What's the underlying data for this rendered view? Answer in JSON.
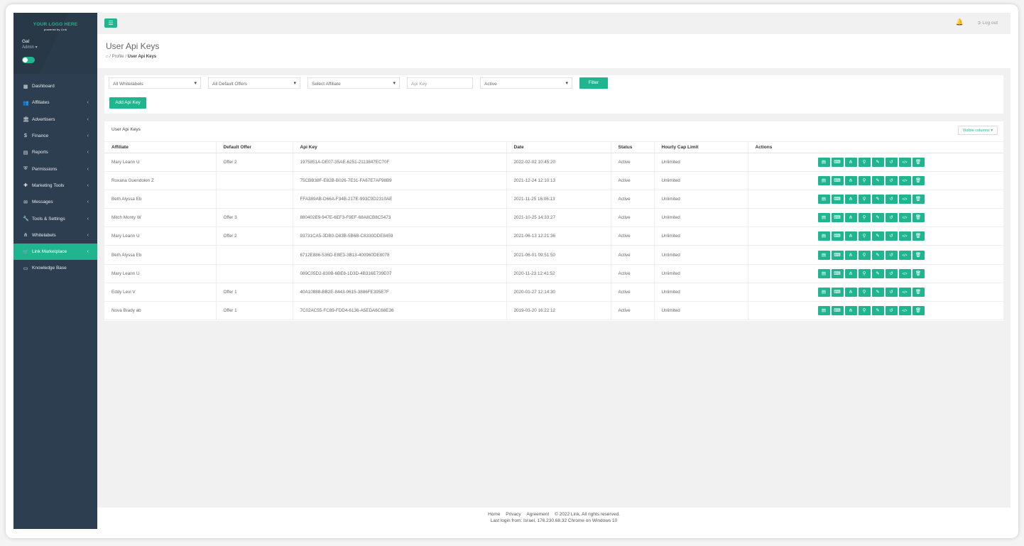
{
  "sidebar": {
    "logo_text": "YOUR LOGO HERE",
    "logo_sub": "powered by Link",
    "user_name": "Gal",
    "user_role": "Admin ▾",
    "items": [
      {
        "label": "Dashboard",
        "icon": "dashboard-icon"
      },
      {
        "label": "Affiliates",
        "icon": "users-icon"
      },
      {
        "label": "Advertisers",
        "icon": "bank-icon"
      },
      {
        "label": "Finance",
        "icon": "money-icon"
      },
      {
        "label": "Reports",
        "icon": "report-icon"
      },
      {
        "label": "Permissions",
        "icon": "shield-icon"
      },
      {
        "label": "Marketing Tools",
        "icon": "puzzle-icon"
      },
      {
        "label": "Messages",
        "icon": "messages-icon"
      },
      {
        "label": "Tools & Settings",
        "icon": "wrench-icon"
      },
      {
        "label": "Whitelabels",
        "icon": "sitemap-icon"
      },
      {
        "label": "Link Marketplace",
        "icon": "store-icon"
      },
      {
        "label": "Knowledge Base",
        "icon": "book-icon"
      }
    ]
  },
  "header": {
    "logout": "Log out"
  },
  "page": {
    "title": "User Api Keys",
    "breadcrumb": [
      "Profile",
      "User Api Keys"
    ]
  },
  "filters": {
    "whitelabels": "All Whitelabels",
    "offers": "All Default Offers",
    "affiliate": "Select Affiliate",
    "api_key_placeholder": "Api Key",
    "status": "Active",
    "filter_btn": "Filter",
    "add_btn": "Add Api Key"
  },
  "table": {
    "caption": "User Api Keys",
    "visible_columns": "Visible columns ▾",
    "columns": [
      "Affiliate",
      "Default Offer",
      "Api Key",
      "Date",
      "Status",
      "Hourly Cap Limit",
      "Actions"
    ],
    "rows": [
      {
        "affiliate": "Mary Leann U",
        "offer": "Offer 2",
        "key": "1975851A-DE07-35AE-6251-2113847EC70F",
        "date": "2022-02-02 10:45:20",
        "status": "Active",
        "cap": "Unlimited"
      },
      {
        "affiliate": "Roxana Guendolen Z",
        "offer": "",
        "key": "75CBB38F-E82B-B026-7E31-FA67E7AF98B9",
        "date": "2021-12-24 12:10:13",
        "status": "Active",
        "cap": "Unlimited"
      },
      {
        "affiliate": "Beth Alyssa Eb",
        "offer": "",
        "key": "FFA389AB-D66A-F34B-217E-993C9D2310AE",
        "date": "2021-11-25 16:06:13",
        "status": "Active",
        "cap": "Unlimited"
      },
      {
        "affiliate": "Mitch Monty W",
        "offer": "Offer 3",
        "key": "880402E9-947E-6EF3-F9EF-68A8CB8C5473",
        "date": "2021-10-25 14:33:27",
        "status": "Active",
        "cap": "Unlimited"
      },
      {
        "affiliate": "Mary Leann U",
        "offer": "Offer 2",
        "key": "93731CA5-3DB0-D83B-5B6B-C8330DDE8459",
        "date": "2021-06-13 12:21:36",
        "status": "Active",
        "cap": "Unlimited"
      },
      {
        "affiliate": "Beth Alyssa Eb",
        "offer": "",
        "key": "6712E886-536D-E8E3-3B13-400960DE8078",
        "date": "2021-06-01 09:51:50",
        "status": "Active",
        "cap": "Unlimited"
      },
      {
        "affiliate": "Mary Leann U",
        "offer": "",
        "key": "089C05D2-830B-6BE8-1D3D-4B316E739E07",
        "date": "2020-11-23 12:41:52",
        "status": "Active",
        "cap": "Unlimited"
      },
      {
        "affiliate": "Eddy Levi V",
        "offer": "Offer 1",
        "key": "40A10888-BB2E-8443-0615-3886FE395E7F",
        "date": "2020-01-27 12:14:30",
        "status": "Active",
        "cap": "Unlimited"
      },
      {
        "affiliate": "Nova Brady ab",
        "offer": "Offer 1",
        "key": "7C02AC55-FC89-FDD4-6136-A5EDA6C68E36",
        "date": "2019-03-20 16:22:12",
        "status": "Active",
        "cap": "Unlimited"
      }
    ],
    "action_icons": [
      "file-icon",
      "keyboard-icon",
      "sitemap-icon",
      "pin-icon",
      "edit-icon",
      "history-icon",
      "code-icon",
      "trash-icon"
    ]
  },
  "footer": {
    "links": [
      "Home",
      "Privacy",
      "Agreement"
    ],
    "copyright": "© 2022 Link. All rights reserved.",
    "last_login": "Last login from: Israel, 176.230.68.32 Chrome on Windows 10"
  },
  "colors": {
    "accent": "#1fb58f",
    "sidebar": "#2c3e4f"
  }
}
